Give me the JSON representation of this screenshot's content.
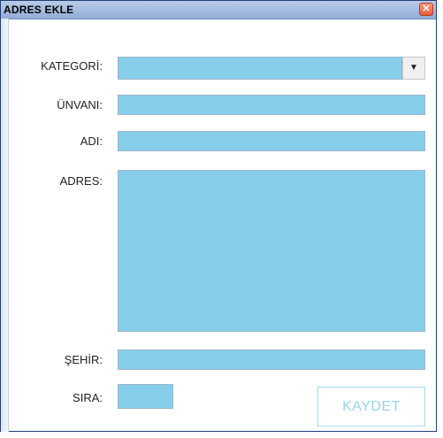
{
  "window": {
    "title": "ADRES EKLE",
    "close_glyph": "✕"
  },
  "form": {
    "kategori_label": "KATEGORİ:",
    "kategori_value": "",
    "kategori_dropdown_icon": "▼",
    "unvani_label": "ÜNVANI:",
    "unvani_value": "",
    "adi_label": "ADI:",
    "adi_value": "",
    "adres_label": "ADRES:",
    "adres_value": "",
    "sehir_label": "ŞEHİR:",
    "sehir_value": "",
    "sira_label": "SIRA:",
    "sira_value": ""
  },
  "actions": {
    "save_label": "KAYDET"
  },
  "colors": {
    "field_bg": "#87ceeb",
    "button_text": "#9bd3ea"
  }
}
